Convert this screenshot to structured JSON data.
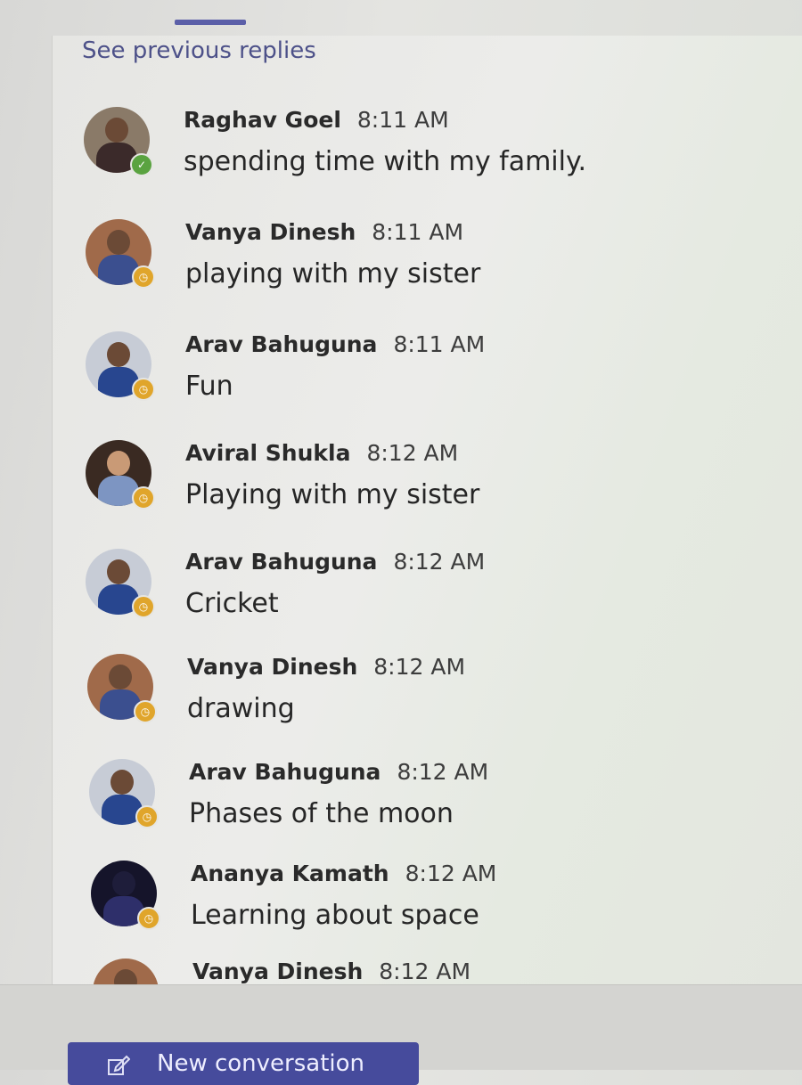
{
  "thread": {
    "see_previous": "See previous replies"
  },
  "messages": [
    {
      "author": "Raghav Goel",
      "time": "8:11 AM",
      "text": "spending time with my family.",
      "status": "available",
      "avatar_bg": "#8a7a68",
      "shirt": "#3b2a2a"
    },
    {
      "author": "Vanya Dinesh",
      "time": "8:11 AM",
      "text": "playing with my sister",
      "status": "away",
      "avatar_bg": "#a06a4a",
      "shirt": "#3b4f8f"
    },
    {
      "author": "Arav Bahuguna",
      "time": "8:11 AM",
      "text": "Fun",
      "status": "away",
      "avatar_bg": "#c7ccd6",
      "shirt": "#28468f"
    },
    {
      "author": "Aviral Shukla",
      "time": "8:12 AM",
      "text": "Playing with my sister",
      "status": "away",
      "avatar_bg": "#3a2a22",
      "shirt": "#7d95c2"
    },
    {
      "author": "Arav Bahuguna",
      "time": "8:12 AM",
      "text": "Cricket",
      "status": "away",
      "avatar_bg": "#c7ccd6",
      "shirt": "#28468f"
    },
    {
      "author": "Vanya Dinesh",
      "time": "8:12 AM",
      "text": "drawing",
      "status": "away",
      "avatar_bg": "#a06a4a",
      "shirt": "#3b4f8f"
    },
    {
      "author": "Arav Bahuguna",
      "time": "8:12 AM",
      "text": "Phases of the moon",
      "status": "away",
      "avatar_bg": "#c7ccd6",
      "shirt": "#28468f"
    },
    {
      "author": "Ananya Kamath",
      "time": "8:12 AM",
      "text": "Learning about space",
      "status": "away",
      "avatar_bg": "#15142a",
      "shirt": "#2e2f6a"
    },
    {
      "author": "Vanya Dinesh",
      "time": "8:12 AM",
      "text": "",
      "status": "away",
      "avatar_bg": "#a06a4a",
      "shirt": "#3b4f8f"
    }
  ],
  "composer": {
    "new_conversation_label": "New conversation"
  },
  "colors": {
    "accent": "#464b9c",
    "link": "#4d5189",
    "available": "#5aa340",
    "away": "#e0a52b"
  }
}
